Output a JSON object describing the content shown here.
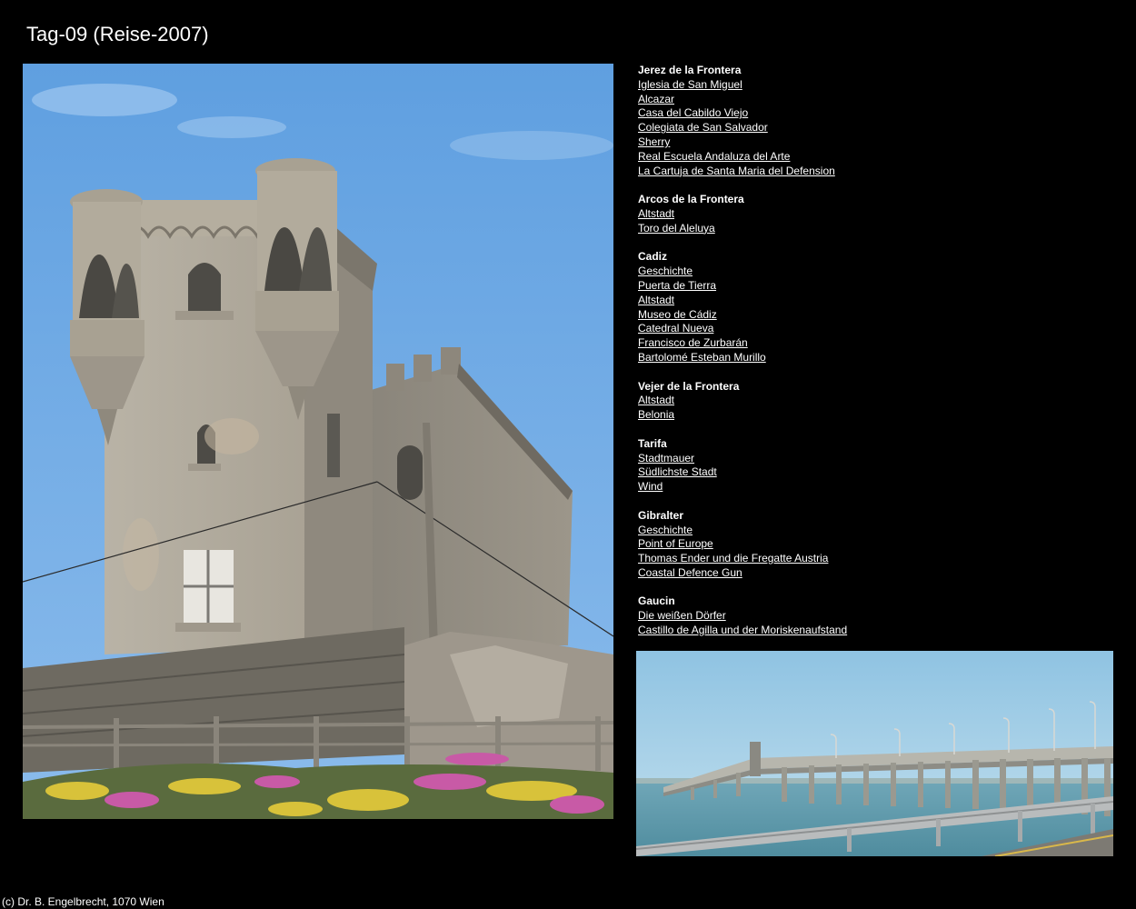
{
  "page": {
    "title": "Tag-09 (Reise-2007)",
    "footer": "(c) Dr. B. Engelbrecht, 1070 Wien"
  },
  "images": {
    "main": "tower-castle-photo",
    "secondary": "long-bridge-photo"
  },
  "sections": [
    {
      "heading": "Jerez de la Frontera",
      "links": [
        "Iglesia de San Miguel",
        "Alcazar",
        "Casa del Cabildo Viejo",
        "Colegiata de San Salvador",
        "Sherry",
        "Real Escuela Andaluza del Arte",
        "La Cartuja de Santa Maria del Defension"
      ]
    },
    {
      "heading": "Arcos de la Frontera",
      "links": [
        "Altstadt",
        "Toro del Aleluya"
      ]
    },
    {
      "heading": "Cadiz",
      "links": [
        "Geschichte",
        "Puerta de Tierra",
        "Altstadt",
        "Museo de Cádiz",
        "Catedral Nueva",
        "Francisco de Zurbarán",
        "Bartolomé Esteban Murillo"
      ]
    },
    {
      "heading": "Vejer de la Frontera",
      "links": [
        "Altstadt",
        "Belonia"
      ]
    },
    {
      "heading": "Tarifa",
      "links": [
        "Stadtmauer",
        "Südlichste Stadt",
        "Wind"
      ]
    },
    {
      "heading": "Gibralter",
      "links": [
        "Geschichte",
        "Point of Europe",
        "Thomas Ender und die Fregatte Austria",
        "Coastal Defence Gun"
      ]
    },
    {
      "heading": "Gaucin",
      "links": [
        "Die weißen Dörfer",
        "Castillo de Agilla und der Moriskenaufstand"
      ]
    }
  ]
}
